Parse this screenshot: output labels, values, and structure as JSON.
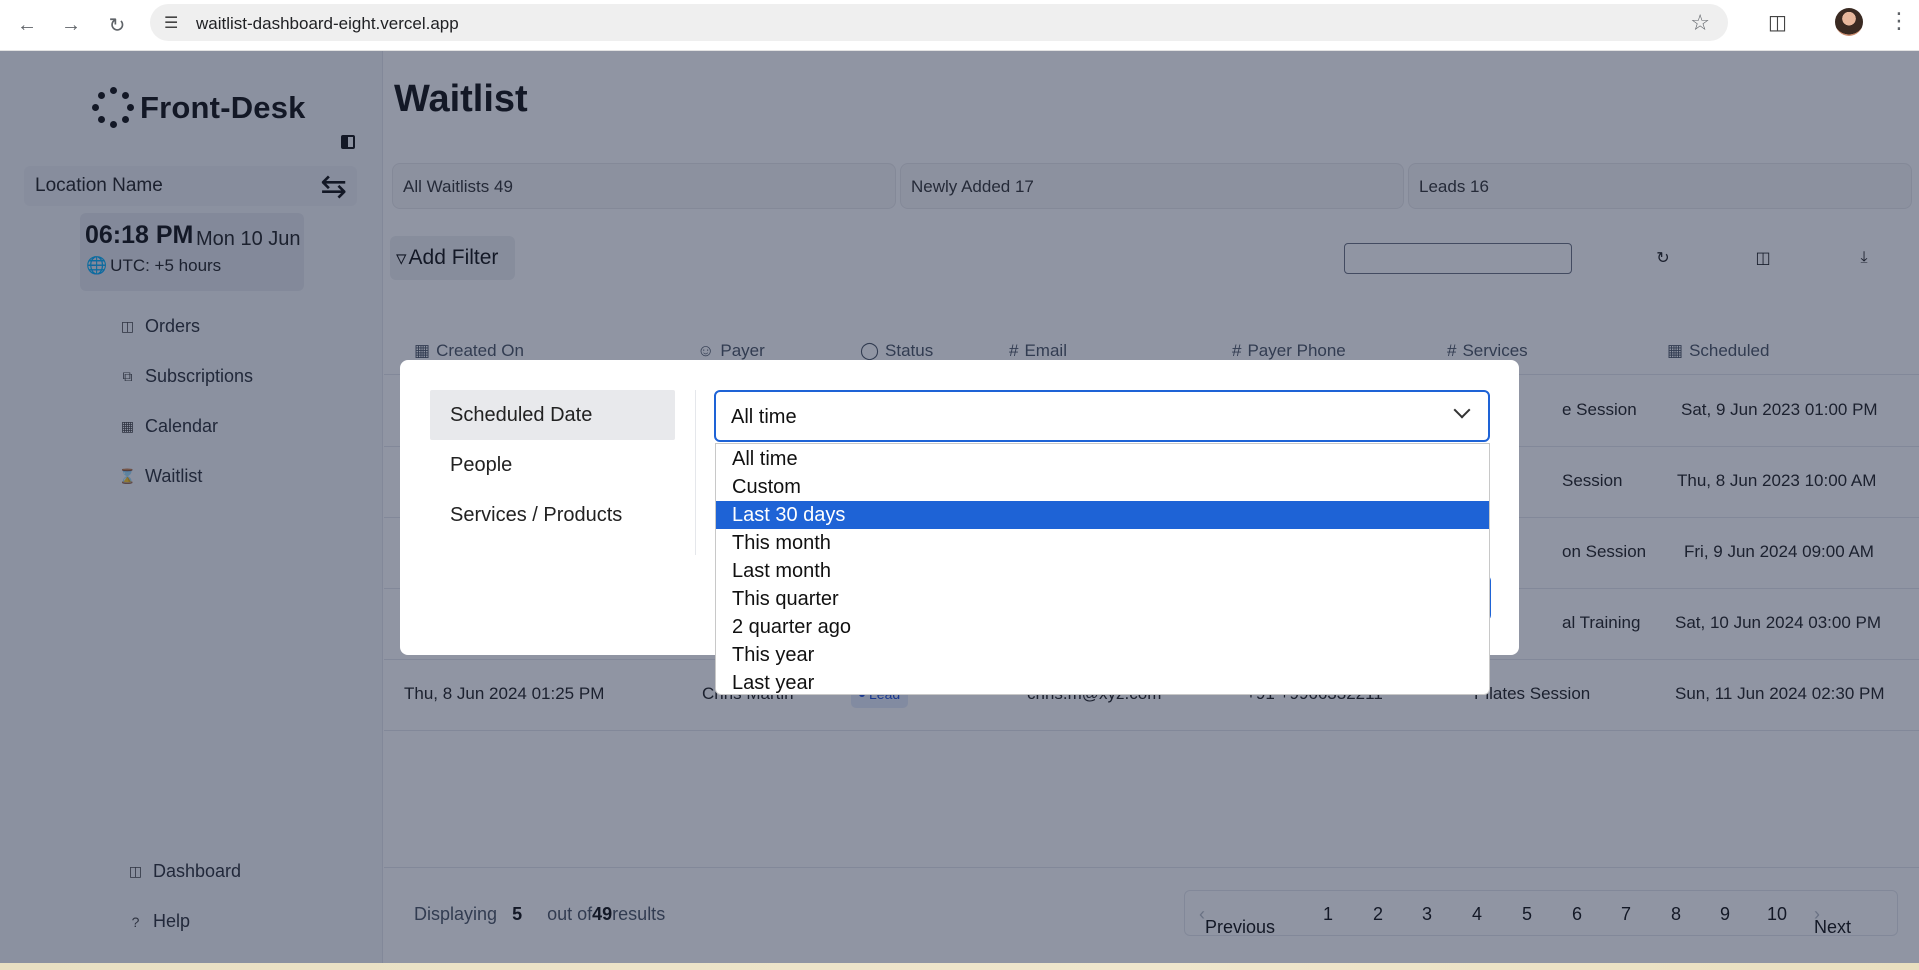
{
  "browser": {
    "url": "waitlist-dashboard-eight.vercel.app"
  },
  "sidebar": {
    "brand": "Front-Desk",
    "location_label": "Location Name",
    "time": "06:18 PM",
    "date": "Mon 10 Jun",
    "timezone": "UTC: +5 hours",
    "nav": [
      {
        "label": "Orders",
        "icon": "box-icon"
      },
      {
        "label": "Subscriptions",
        "icon": "stack-icon"
      },
      {
        "label": "Calendar",
        "icon": "calendar-icon"
      },
      {
        "label": "Waitlist",
        "icon": "hourglass-icon"
      }
    ],
    "bottom_nav": [
      {
        "label": "Dashboard",
        "icon": "dashboard-icon"
      },
      {
        "label": "Help",
        "icon": "help-icon"
      }
    ]
  },
  "main": {
    "title": "Waitlist",
    "stats": [
      {
        "label": "All Waitlists 49"
      },
      {
        "label": "Newly Added 17"
      },
      {
        "label": "Leads 16"
      }
    ],
    "add_filter_label": "Add Filter",
    "table": {
      "headers": [
        "Created On",
        "Payer",
        "Status",
        "Email",
        "Payer Phone",
        "Services",
        "Scheduled"
      ],
      "rows": [
        {
          "scheduled": "Sat, 9 Jun 2023 01:00 PM",
          "service_fragment": "e Session"
        },
        {
          "scheduled": "Thu, 8 Jun 2023 10:00 AM",
          "service_fragment": "Session"
        },
        {
          "scheduled": "Fri, 9 Jun 2024 09:00 AM",
          "service_fragment": "on Session"
        },
        {
          "scheduled": "Sat, 10 Jun 2024 03:00 PM",
          "service_fragment": "al Training"
        },
        {
          "created": "Thu, 8 Jun 2024 01:25 PM",
          "payer": "Chris Martin",
          "status": "Lead",
          "email": "chris.m@xyz.com",
          "phone": "+91 +9966332211",
          "service": "Pilates Session",
          "scheduled": "Sun, 11 Jun 2024 02:30 PM"
        }
      ]
    },
    "footer": {
      "displaying_label": "Displaying",
      "displaying_count": "5",
      "out_of_label": "out of",
      "total": "49",
      "results_label": "results",
      "previous": "Previous",
      "next": "Next",
      "pages": [
        "1",
        "2",
        "3",
        "4",
        "5",
        "6",
        "7",
        "8",
        "9",
        "10"
      ]
    }
  },
  "filter_modal": {
    "categories": [
      "Scheduled Date",
      "People",
      "Services / Products"
    ],
    "active_category": "Scheduled Date",
    "select_value": "All time",
    "options": [
      "All time",
      "Custom",
      "Last 30 days",
      "This month",
      "Last month",
      "This quarter",
      "2 quarter ago",
      "This year",
      "Last year"
    ],
    "highlighted_option": "Last 30 days"
  },
  "colors": {
    "accent": "#1e63d6",
    "overlay": "#16213e",
    "badge_bg": "#e4ecfb",
    "badge_text": "#1d4ed8"
  }
}
